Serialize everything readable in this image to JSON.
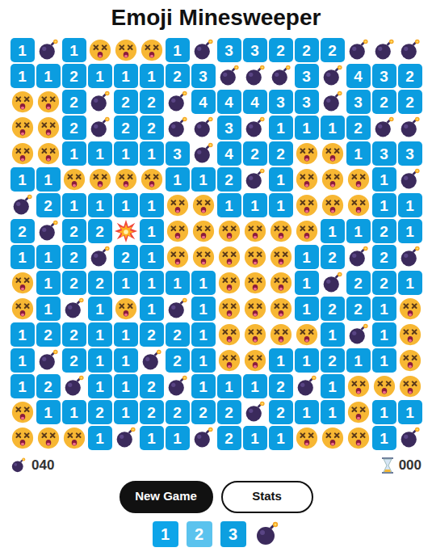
{
  "title": "Emoji Minesweeper",
  "grid": [
    [
      {
        "kind": "number",
        "text": "1"
      },
      {
        "kind": "bomb"
      },
      {
        "kind": "number",
        "text": "1"
      },
      {
        "kind": "face"
      },
      {
        "kind": "face"
      },
      {
        "kind": "face"
      },
      {
        "kind": "number",
        "text": "1"
      },
      {
        "kind": "bomb"
      },
      {
        "kind": "number",
        "text": "3"
      },
      {
        "kind": "number",
        "text": "3"
      },
      {
        "kind": "number",
        "text": "2"
      },
      {
        "kind": "number",
        "text": "2"
      },
      {
        "kind": "number",
        "text": "2"
      },
      {
        "kind": "bomb"
      },
      {
        "kind": "bomb"
      },
      {
        "kind": "bomb"
      }
    ],
    [
      {
        "kind": "number",
        "text": "1"
      },
      {
        "kind": "number",
        "text": "1"
      },
      {
        "kind": "number",
        "text": "2"
      },
      {
        "kind": "number",
        "text": "1"
      },
      {
        "kind": "number",
        "text": "1"
      },
      {
        "kind": "number",
        "text": "1"
      },
      {
        "kind": "number",
        "text": "2"
      },
      {
        "kind": "number",
        "text": "3"
      },
      {
        "kind": "bomb"
      },
      {
        "kind": "bomb"
      },
      {
        "kind": "bomb"
      },
      {
        "kind": "number",
        "text": "3"
      },
      {
        "kind": "bomb"
      },
      {
        "kind": "number",
        "text": "4"
      },
      {
        "kind": "number",
        "text": "3"
      },
      {
        "kind": "number",
        "text": "2"
      }
    ],
    [
      {
        "kind": "face"
      },
      {
        "kind": "face"
      },
      {
        "kind": "number",
        "text": "2"
      },
      {
        "kind": "bomb"
      },
      {
        "kind": "number",
        "text": "2"
      },
      {
        "kind": "number",
        "text": "2"
      },
      {
        "kind": "bomb"
      },
      {
        "kind": "number",
        "text": "4"
      },
      {
        "kind": "number",
        "text": "4"
      },
      {
        "kind": "number",
        "text": "4"
      },
      {
        "kind": "number",
        "text": "3"
      },
      {
        "kind": "number",
        "text": "3"
      },
      {
        "kind": "bomb"
      },
      {
        "kind": "number",
        "text": "3"
      },
      {
        "kind": "number",
        "text": "2"
      },
      {
        "kind": "number",
        "text": "2"
      }
    ],
    [
      {
        "kind": "face"
      },
      {
        "kind": "face"
      },
      {
        "kind": "number",
        "text": "2"
      },
      {
        "kind": "bomb"
      },
      {
        "kind": "number",
        "text": "2"
      },
      {
        "kind": "number",
        "text": "2"
      },
      {
        "kind": "bomb"
      },
      {
        "kind": "bomb"
      },
      {
        "kind": "number",
        "text": "3"
      },
      {
        "kind": "bomb"
      },
      {
        "kind": "number",
        "text": "1"
      },
      {
        "kind": "number",
        "text": "1"
      },
      {
        "kind": "number",
        "text": "1"
      },
      {
        "kind": "number",
        "text": "2"
      },
      {
        "kind": "bomb"
      },
      {
        "kind": "bomb"
      }
    ],
    [
      {
        "kind": "face"
      },
      {
        "kind": "face"
      },
      {
        "kind": "number",
        "text": "1"
      },
      {
        "kind": "number",
        "text": "1"
      },
      {
        "kind": "number",
        "text": "1"
      },
      {
        "kind": "number",
        "text": "1"
      },
      {
        "kind": "number",
        "text": "3"
      },
      {
        "kind": "bomb"
      },
      {
        "kind": "number",
        "text": "4"
      },
      {
        "kind": "number",
        "text": "2"
      },
      {
        "kind": "number",
        "text": "2"
      },
      {
        "kind": "face"
      },
      {
        "kind": "face"
      },
      {
        "kind": "number",
        "text": "1"
      },
      {
        "kind": "number",
        "text": "3"
      },
      {
        "kind": "number",
        "text": "3"
      }
    ],
    [
      {
        "kind": "number",
        "text": "1"
      },
      {
        "kind": "number",
        "text": "1"
      },
      {
        "kind": "face"
      },
      {
        "kind": "face"
      },
      {
        "kind": "face"
      },
      {
        "kind": "face"
      },
      {
        "kind": "number",
        "text": "1"
      },
      {
        "kind": "number",
        "text": "1"
      },
      {
        "kind": "number",
        "text": "2"
      },
      {
        "kind": "bomb"
      },
      {
        "kind": "number",
        "text": "1"
      },
      {
        "kind": "face"
      },
      {
        "kind": "face"
      },
      {
        "kind": "face"
      },
      {
        "kind": "number",
        "text": "1"
      },
      {
        "kind": "bomb"
      }
    ],
    [
      {
        "kind": "bomb"
      },
      {
        "kind": "number",
        "text": "2"
      },
      {
        "kind": "number",
        "text": "1"
      },
      {
        "kind": "number",
        "text": "1"
      },
      {
        "kind": "number",
        "text": "1"
      },
      {
        "kind": "number",
        "text": "1"
      },
      {
        "kind": "face"
      },
      {
        "kind": "face"
      },
      {
        "kind": "number",
        "text": "1"
      },
      {
        "kind": "number",
        "text": "1"
      },
      {
        "kind": "number",
        "text": "1"
      },
      {
        "kind": "face"
      },
      {
        "kind": "face"
      },
      {
        "kind": "face"
      },
      {
        "kind": "number",
        "text": "1"
      },
      {
        "kind": "number",
        "text": "1"
      }
    ],
    [
      {
        "kind": "number",
        "text": "2"
      },
      {
        "kind": "bomb"
      },
      {
        "kind": "number",
        "text": "2"
      },
      {
        "kind": "number",
        "text": "2"
      },
      {
        "kind": "explosion"
      },
      {
        "kind": "number",
        "text": "1"
      },
      {
        "kind": "face"
      },
      {
        "kind": "face"
      },
      {
        "kind": "face"
      },
      {
        "kind": "face"
      },
      {
        "kind": "face"
      },
      {
        "kind": "face"
      },
      {
        "kind": "number",
        "text": "1"
      },
      {
        "kind": "number",
        "text": "1"
      },
      {
        "kind": "number",
        "text": "2"
      },
      {
        "kind": "number",
        "text": "1"
      }
    ],
    [
      {
        "kind": "number",
        "text": "1"
      },
      {
        "kind": "number",
        "text": "1"
      },
      {
        "kind": "number",
        "text": "2"
      },
      {
        "kind": "bomb"
      },
      {
        "kind": "number",
        "text": "2"
      },
      {
        "kind": "number",
        "text": "1"
      },
      {
        "kind": "face"
      },
      {
        "kind": "face"
      },
      {
        "kind": "face"
      },
      {
        "kind": "face"
      },
      {
        "kind": "face"
      },
      {
        "kind": "number",
        "text": "1"
      },
      {
        "kind": "number",
        "text": "2"
      },
      {
        "kind": "bomb"
      },
      {
        "kind": "number",
        "text": "2"
      },
      {
        "kind": "bomb"
      }
    ],
    [
      {
        "kind": "face"
      },
      {
        "kind": "number",
        "text": "1"
      },
      {
        "kind": "number",
        "text": "2"
      },
      {
        "kind": "number",
        "text": "2"
      },
      {
        "kind": "number",
        "text": "1"
      },
      {
        "kind": "number",
        "text": "1"
      },
      {
        "kind": "number",
        "text": "1"
      },
      {
        "kind": "number",
        "text": "1"
      },
      {
        "kind": "face"
      },
      {
        "kind": "face"
      },
      {
        "kind": "face"
      },
      {
        "kind": "number",
        "text": "1"
      },
      {
        "kind": "bomb"
      },
      {
        "kind": "number",
        "text": "2"
      },
      {
        "kind": "number",
        "text": "2"
      },
      {
        "kind": "number",
        "text": "1"
      }
    ],
    [
      {
        "kind": "face"
      },
      {
        "kind": "number",
        "text": "1"
      },
      {
        "kind": "bomb"
      },
      {
        "kind": "number",
        "text": "1"
      },
      {
        "kind": "face"
      },
      {
        "kind": "number",
        "text": "1"
      },
      {
        "kind": "bomb"
      },
      {
        "kind": "number",
        "text": "1"
      },
      {
        "kind": "face"
      },
      {
        "kind": "face"
      },
      {
        "kind": "face"
      },
      {
        "kind": "number",
        "text": "1"
      },
      {
        "kind": "number",
        "text": "2"
      },
      {
        "kind": "number",
        "text": "2"
      },
      {
        "kind": "number",
        "text": "1"
      },
      {
        "kind": "face"
      }
    ],
    [
      {
        "kind": "number",
        "text": "1"
      },
      {
        "kind": "number",
        "text": "2"
      },
      {
        "kind": "number",
        "text": "2"
      },
      {
        "kind": "number",
        "text": "1"
      },
      {
        "kind": "number",
        "text": "1"
      },
      {
        "kind": "number",
        "text": "2"
      },
      {
        "kind": "number",
        "text": "2"
      },
      {
        "kind": "number",
        "text": "1"
      },
      {
        "kind": "face"
      },
      {
        "kind": "face"
      },
      {
        "kind": "face"
      },
      {
        "kind": "face"
      },
      {
        "kind": "number",
        "text": "1"
      },
      {
        "kind": "bomb"
      },
      {
        "kind": "number",
        "text": "1"
      },
      {
        "kind": "face"
      }
    ],
    [
      {
        "kind": "number",
        "text": "1"
      },
      {
        "kind": "bomb"
      },
      {
        "kind": "number",
        "text": "2"
      },
      {
        "kind": "number",
        "text": "1"
      },
      {
        "kind": "number",
        "text": "1"
      },
      {
        "kind": "bomb"
      },
      {
        "kind": "number",
        "text": "2"
      },
      {
        "kind": "number",
        "text": "1"
      },
      {
        "kind": "face"
      },
      {
        "kind": "face"
      },
      {
        "kind": "number",
        "text": "1"
      },
      {
        "kind": "number",
        "text": "1"
      },
      {
        "kind": "number",
        "text": "2"
      },
      {
        "kind": "number",
        "text": "1"
      },
      {
        "kind": "number",
        "text": "1"
      },
      {
        "kind": "face"
      }
    ],
    [
      {
        "kind": "number",
        "text": "1"
      },
      {
        "kind": "number",
        "text": "2"
      },
      {
        "kind": "bomb"
      },
      {
        "kind": "number",
        "text": "1"
      },
      {
        "kind": "number",
        "text": "1"
      },
      {
        "kind": "number",
        "text": "2"
      },
      {
        "kind": "bomb"
      },
      {
        "kind": "number",
        "text": "1"
      },
      {
        "kind": "number",
        "text": "1"
      },
      {
        "kind": "number",
        "text": "1"
      },
      {
        "kind": "number",
        "text": "2"
      },
      {
        "kind": "bomb"
      },
      {
        "kind": "number",
        "text": "1"
      },
      {
        "kind": "face"
      },
      {
        "kind": "face"
      },
      {
        "kind": "face"
      }
    ],
    [
      {
        "kind": "face"
      },
      {
        "kind": "number",
        "text": "1"
      },
      {
        "kind": "number",
        "text": "1"
      },
      {
        "kind": "number",
        "text": "2"
      },
      {
        "kind": "number",
        "text": "1"
      },
      {
        "kind": "number",
        "text": "2"
      },
      {
        "kind": "number",
        "text": "2"
      },
      {
        "kind": "number",
        "text": "2"
      },
      {
        "kind": "number",
        "text": "2"
      },
      {
        "kind": "bomb"
      },
      {
        "kind": "number",
        "text": "2"
      },
      {
        "kind": "number",
        "text": "1"
      },
      {
        "kind": "number",
        "text": "1"
      },
      {
        "kind": "face"
      },
      {
        "kind": "number",
        "text": "1"
      },
      {
        "kind": "number",
        "text": "1"
      }
    ],
    [
      {
        "kind": "face"
      },
      {
        "kind": "face"
      },
      {
        "kind": "face"
      },
      {
        "kind": "number",
        "text": "1"
      },
      {
        "kind": "bomb"
      },
      {
        "kind": "number",
        "text": "1"
      },
      {
        "kind": "number",
        "text": "1"
      },
      {
        "kind": "bomb"
      },
      {
        "kind": "number",
        "text": "2"
      },
      {
        "kind": "number",
        "text": "1"
      },
      {
        "kind": "number",
        "text": "1"
      },
      {
        "kind": "face"
      },
      {
        "kind": "face"
      },
      {
        "kind": "face"
      },
      {
        "kind": "number",
        "text": "1"
      },
      {
        "kind": "bomb"
      }
    ]
  ],
  "mine_counter": "040",
  "timer": "000",
  "buttons": [
    {
      "label": "New Game",
      "kind": "primary"
    },
    {
      "label": "Stats",
      "kind": "outline"
    }
  ],
  "legend": [
    {
      "kind": "number",
      "text": "1",
      "color": "#0ea5e9"
    },
    {
      "kind": "number",
      "text": "2",
      "color": "#5bc3ee"
    },
    {
      "kind": "number",
      "text": "3",
      "color": "#0d9fe0"
    },
    {
      "kind": "bomb"
    }
  ]
}
